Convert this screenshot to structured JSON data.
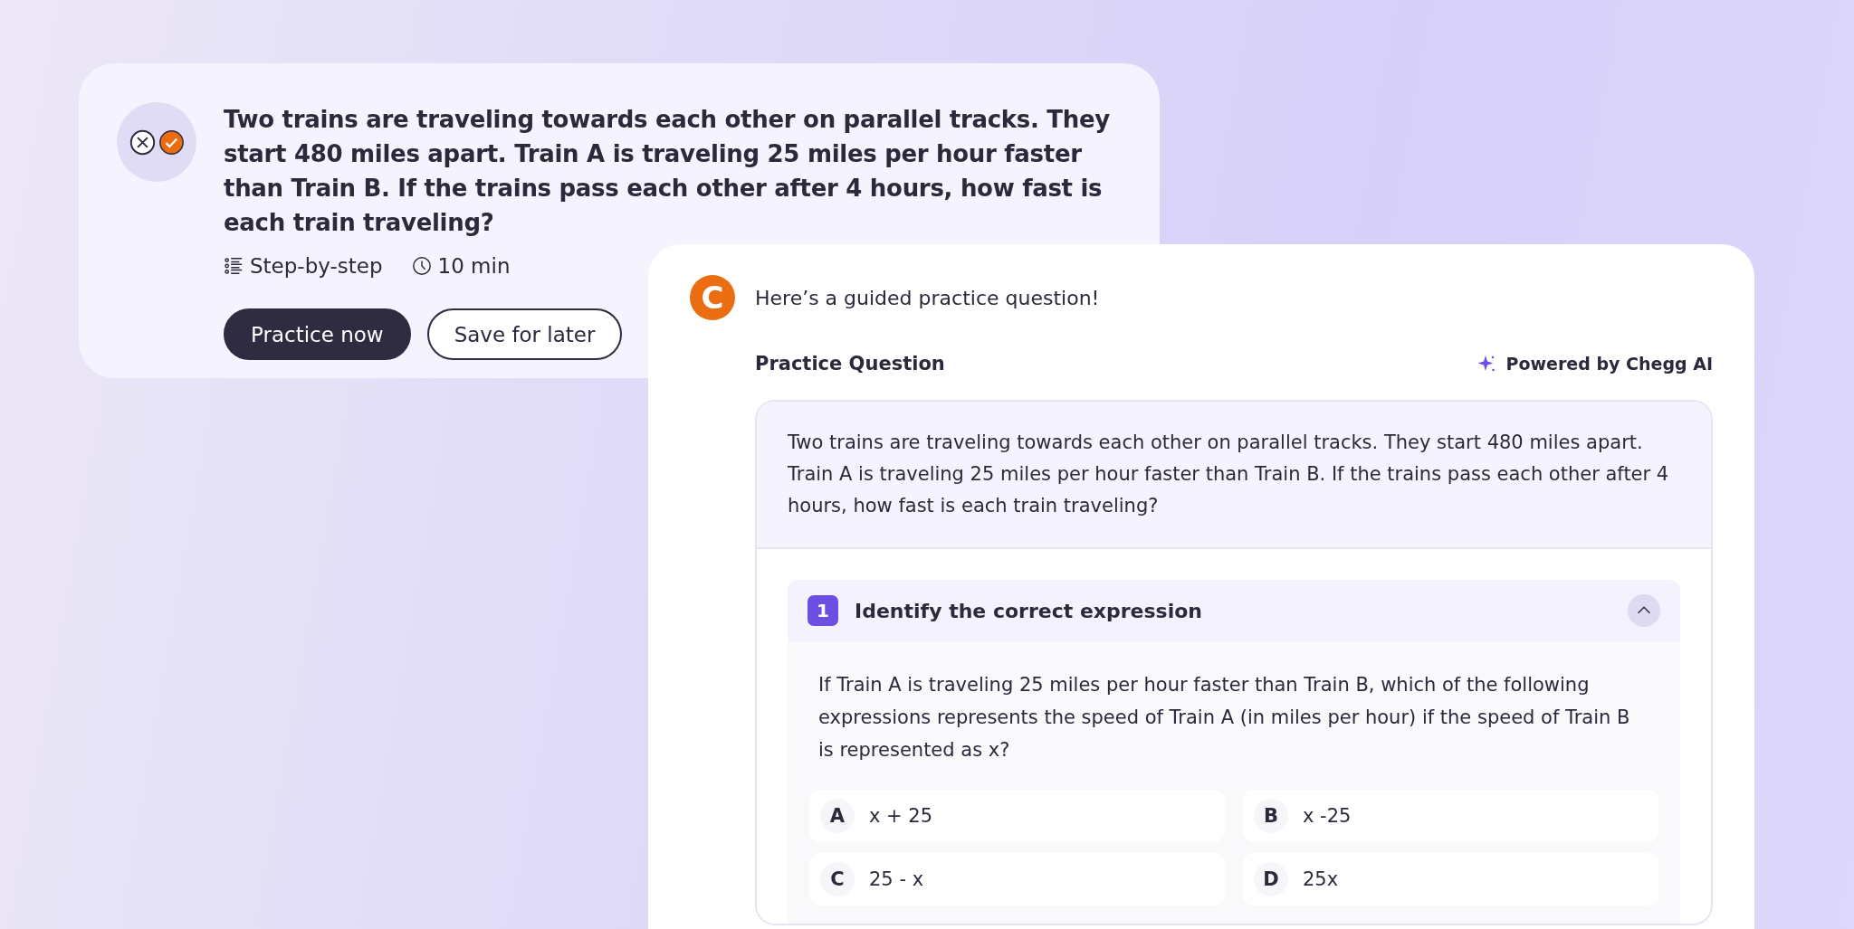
{
  "practice_card": {
    "title": "Two trains are traveling towards each other on parallel tracks. They start 480 miles apart. Train A is traveling 25 miles per hour faster than Train B. If the trains pass each other after 4 hours, how fast is each train traveling?",
    "meta": [
      {
        "kind": "steps",
        "label": "Step-by-step"
      },
      {
        "kind": "time",
        "label": "10 min"
      }
    ],
    "buttons": [
      {
        "kind": "primary",
        "label": "Practice now"
      },
      {
        "kind": "secondary",
        "label": "Save for later"
      }
    ]
  },
  "chat": {
    "avatar": "C",
    "message": "Here’s a guided practice question!",
    "heading": "Practice Question",
    "powered_by": "Powered by Chegg AI",
    "question": "Two trains are traveling towards each other on parallel tracks. They start 480 miles apart. Train A is traveling 25 miles per hour faster than Train B. If the trains pass each other after 4 hours, how fast is each train traveling?",
    "step": {
      "number": "1",
      "title": "Identify the correct expression",
      "expanded": true,
      "prompt": "If Train A is traveling 25 miles per hour faster than Train B, which of the following expressions represents the speed of Train A (in miles per hour) if the speed of Train B is represented as x?",
      "options": [
        {
          "letter": "A",
          "text": "x + 25"
        },
        {
          "letter": "B",
          "text": "x -25"
        },
        {
          "letter": "C",
          "text": "25 - x"
        },
        {
          "letter": "D",
          "text": "25x"
        }
      ]
    }
  }
}
